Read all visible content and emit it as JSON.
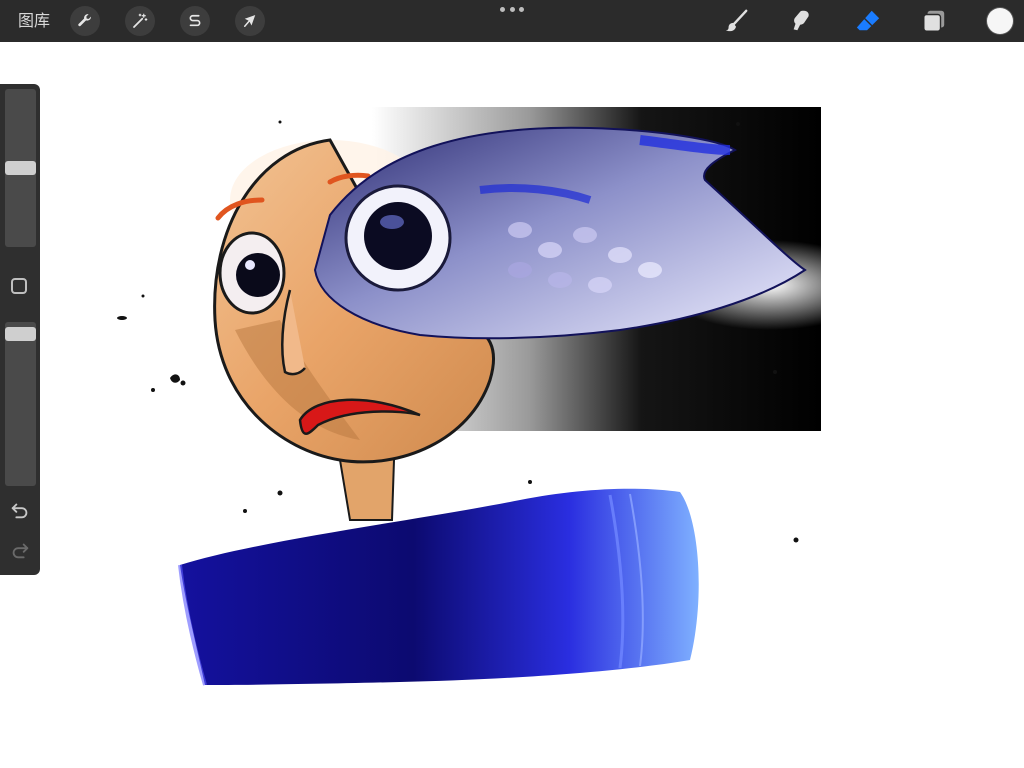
{
  "toolbar": {
    "gallery_label": "图库",
    "left_tools": [
      {
        "name": "actions",
        "icon": "wrench-icon"
      },
      {
        "name": "adjustments",
        "icon": "magic-wand-icon"
      },
      {
        "name": "selection",
        "icon": "selection-s-icon"
      },
      {
        "name": "transform",
        "icon": "arrow-cursor-icon"
      }
    ],
    "right_tools": [
      {
        "name": "brush",
        "icon": "brush-icon",
        "active": false
      },
      {
        "name": "smudge",
        "icon": "smudge-icon",
        "active": false
      },
      {
        "name": "eraser",
        "icon": "eraser-icon",
        "active": true
      },
      {
        "name": "layers",
        "icon": "layers-icon",
        "active": false
      }
    ],
    "current_color": "#f6f6f6",
    "accent_color": "#1a7cff"
  },
  "sidebar": {
    "brush_size_level": 0.5,
    "opacity_level": 0.95,
    "buttons": [
      "modify-square-icon",
      "undo-icon",
      "redo-icon"
    ]
  }
}
